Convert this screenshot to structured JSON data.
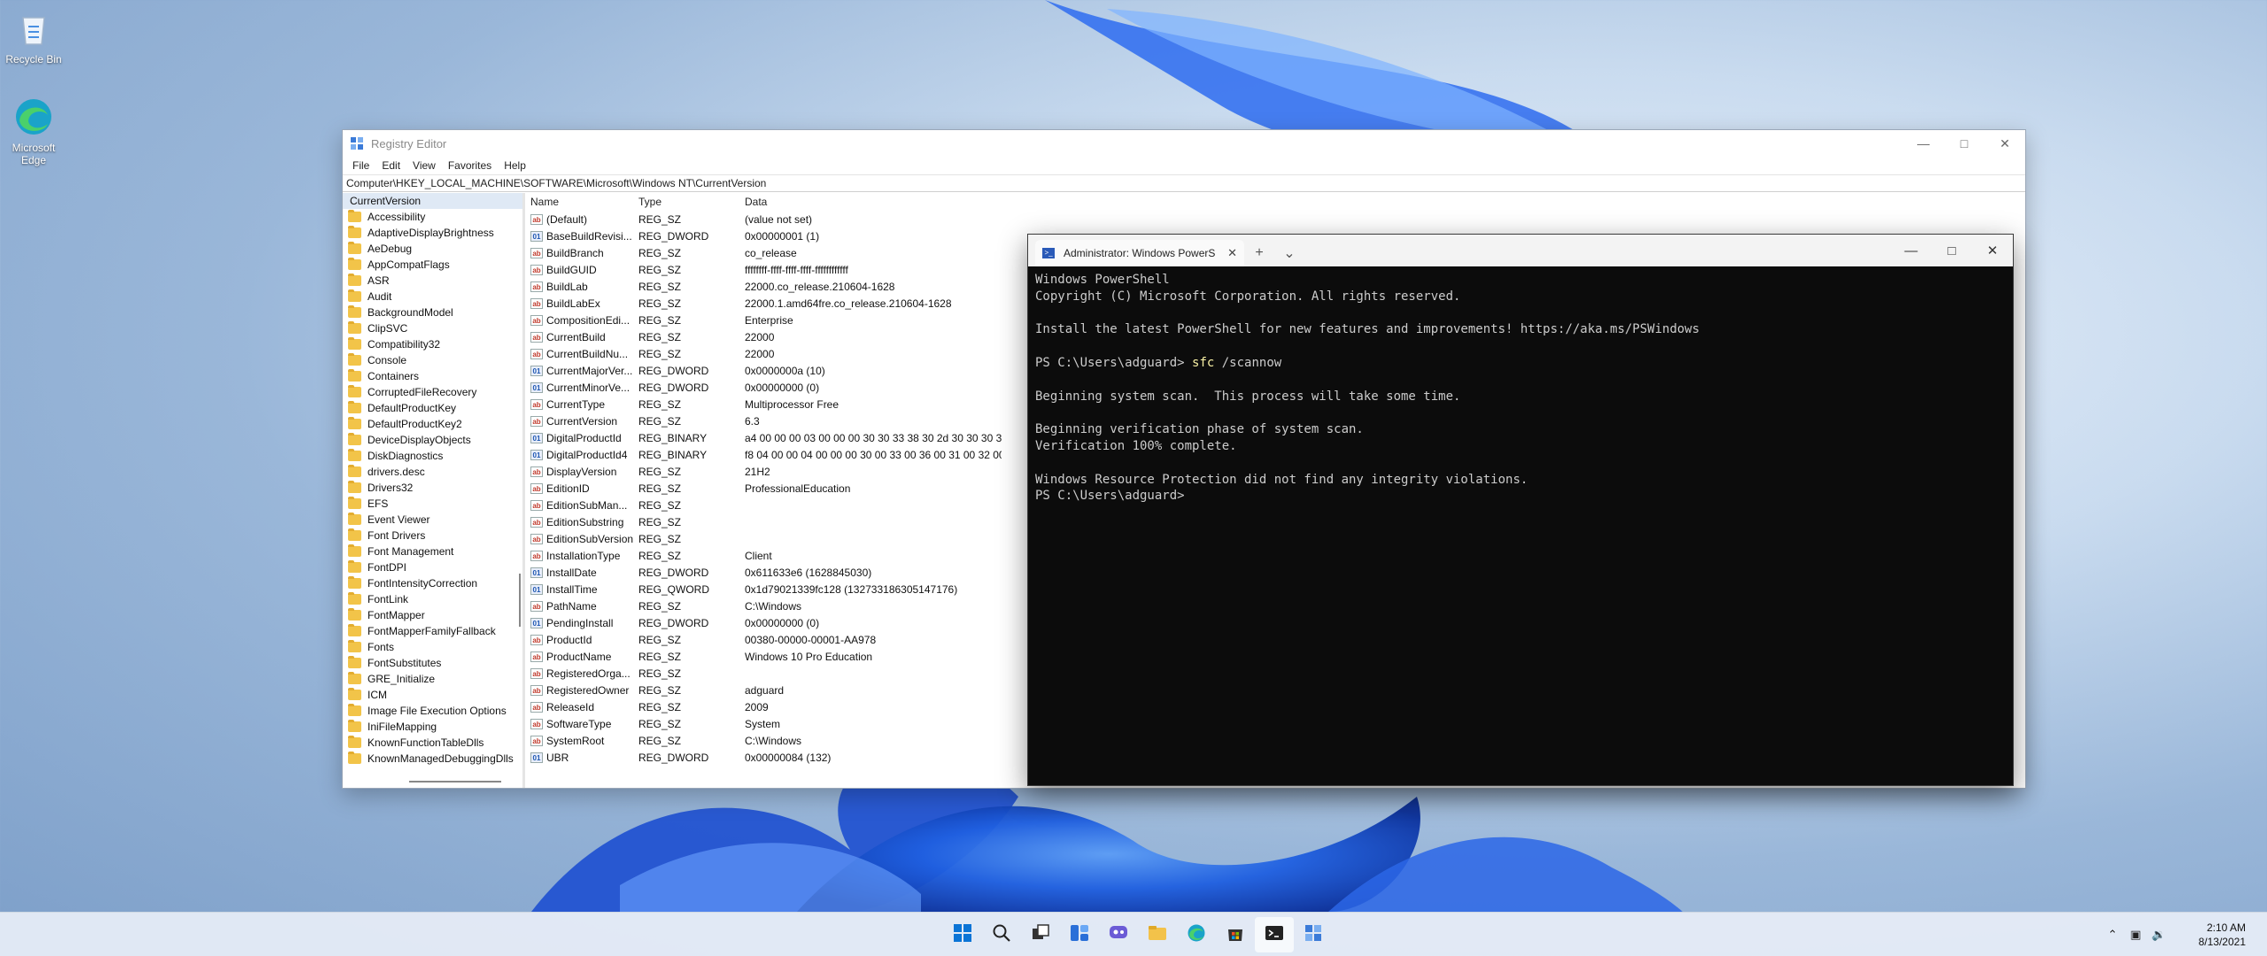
{
  "desktop": {
    "icons": [
      {
        "label": "Recycle Bin",
        "icon": "recycle-bin-icon"
      },
      {
        "label": "Microsoft Edge",
        "icon": "edge-icon"
      }
    ]
  },
  "regedit": {
    "title": "Registry Editor",
    "menu": [
      "File",
      "Edit",
      "View",
      "Favorites",
      "Help"
    ],
    "address": "Computer\\HKEY_LOCAL_MACHINE\\SOFTWARE\\Microsoft\\Windows NT\\CurrentVersion",
    "tree": [
      "CurrentVersion",
      "Accessibility",
      "AdaptiveDisplayBrightness",
      "AeDebug",
      "AppCompatFlags",
      "ASR",
      "Audit",
      "BackgroundModel",
      "ClipSVC",
      "Compatibility32",
      "Console",
      "Containers",
      "CorruptedFileRecovery",
      "DefaultProductKey",
      "DefaultProductKey2",
      "DeviceDisplayObjects",
      "DiskDiagnostics",
      "drivers.desc",
      "Drivers32",
      "EFS",
      "Event Viewer",
      "Font Drivers",
      "Font Management",
      "FontDPI",
      "FontIntensityCorrection",
      "FontLink",
      "FontMapper",
      "FontMapperFamilyFallback",
      "Fonts",
      "FontSubstitutes",
      "GRE_Initialize",
      "ICM",
      "Image File Execution Options",
      "IniFileMapping",
      "KnownFunctionTableDlls",
      "KnownManagedDebuggingDlls"
    ],
    "columns": {
      "name": "Name",
      "type": "Type",
      "data": "Data"
    },
    "values": [
      {
        "name": "(Default)",
        "type": "REG_SZ",
        "data": "(value not set)",
        "kind": "str"
      },
      {
        "name": "BaseBuildRevisi...",
        "type": "REG_DWORD",
        "data": "0x00000001 (1)",
        "kind": "bin"
      },
      {
        "name": "BuildBranch",
        "type": "REG_SZ",
        "data": "co_release",
        "kind": "str"
      },
      {
        "name": "BuildGUID",
        "type": "REG_SZ",
        "data": "ffffffff-ffff-ffff-ffff-ffffffffffff",
        "kind": "str"
      },
      {
        "name": "BuildLab",
        "type": "REG_SZ",
        "data": "22000.co_release.210604-1628",
        "kind": "str"
      },
      {
        "name": "BuildLabEx",
        "type": "REG_SZ",
        "data": "22000.1.amd64fre.co_release.210604-1628",
        "kind": "str"
      },
      {
        "name": "CompositionEdi...",
        "type": "REG_SZ",
        "data": "Enterprise",
        "kind": "str"
      },
      {
        "name": "CurrentBuild",
        "type": "REG_SZ",
        "data": "22000",
        "kind": "str"
      },
      {
        "name": "CurrentBuildNu...",
        "type": "REG_SZ",
        "data": "22000",
        "kind": "str"
      },
      {
        "name": "CurrentMajorVer...",
        "type": "REG_DWORD",
        "data": "0x0000000a (10)",
        "kind": "bin"
      },
      {
        "name": "CurrentMinorVe...",
        "type": "REG_DWORD",
        "data": "0x00000000 (0)",
        "kind": "bin"
      },
      {
        "name": "CurrentType",
        "type": "REG_SZ",
        "data": "Multiprocessor Free",
        "kind": "str"
      },
      {
        "name": "CurrentVersion",
        "type": "REG_SZ",
        "data": "6.3",
        "kind": "str"
      },
      {
        "name": "DigitalProductId",
        "type": "REG_BINARY",
        "data": "a4 00 00 00 03 00 00 00 30 30 33 38 30 2d 30 30 30 3...",
        "kind": "bin"
      },
      {
        "name": "DigitalProductId4",
        "type": "REG_BINARY",
        "data": "f8 04 00 00 04 00 00 00 30 00 33 00 36 00 31 00 32 00...",
        "kind": "bin"
      },
      {
        "name": "DisplayVersion",
        "type": "REG_SZ",
        "data": "21H2",
        "kind": "str"
      },
      {
        "name": "EditionID",
        "type": "REG_SZ",
        "data": "ProfessionalEducation",
        "kind": "str"
      },
      {
        "name": "EditionSubMan...",
        "type": "REG_SZ",
        "data": "",
        "kind": "str"
      },
      {
        "name": "EditionSubstring",
        "type": "REG_SZ",
        "data": "",
        "kind": "str"
      },
      {
        "name": "EditionSubVersion",
        "type": "REG_SZ",
        "data": "",
        "kind": "str"
      },
      {
        "name": "InstallationType",
        "type": "REG_SZ",
        "data": "Client",
        "kind": "str"
      },
      {
        "name": "InstallDate",
        "type": "REG_DWORD",
        "data": "0x611633e6 (1628845030)",
        "kind": "bin"
      },
      {
        "name": "InstallTime",
        "type": "REG_QWORD",
        "data": "0x1d79021339fc128 (132733186305147176)",
        "kind": "bin"
      },
      {
        "name": "PathName",
        "type": "REG_SZ",
        "data": "C:\\Windows",
        "kind": "str"
      },
      {
        "name": "PendingInstall",
        "type": "REG_DWORD",
        "data": "0x00000000 (0)",
        "kind": "bin"
      },
      {
        "name": "ProductId",
        "type": "REG_SZ",
        "data": "00380-00000-00001-AA978",
        "kind": "str"
      },
      {
        "name": "ProductName",
        "type": "REG_SZ",
        "data": "Windows 10 Pro Education",
        "kind": "str"
      },
      {
        "name": "RegisteredOrga...",
        "type": "REG_SZ",
        "data": "",
        "kind": "str"
      },
      {
        "name": "RegisteredOwner",
        "type": "REG_SZ",
        "data": "adguard",
        "kind": "str"
      },
      {
        "name": "ReleaseId",
        "type": "REG_SZ",
        "data": "2009",
        "kind": "str"
      },
      {
        "name": "SoftwareType",
        "type": "REG_SZ",
        "data": "System",
        "kind": "str"
      },
      {
        "name": "SystemRoot",
        "type": "REG_SZ",
        "data": "C:\\Windows",
        "kind": "str"
      },
      {
        "name": "UBR",
        "type": "REG_DWORD",
        "data": "0x00000084 (132)",
        "kind": "bin"
      }
    ]
  },
  "terminal": {
    "tab_title": "Administrator: Windows PowerS",
    "lines": [
      {
        "text": "Windows PowerShell"
      },
      {
        "text": "Copyright (C) Microsoft Corporation. All rights reserved."
      },
      {
        "text": ""
      },
      {
        "text": "Install the latest PowerShell for new features and improvements! https://aka.ms/PSWindows"
      },
      {
        "text": ""
      },
      {
        "prompt": "PS C:\\Users\\adguard> ",
        "cmd": "sfc",
        "text": " /scannow"
      },
      {
        "text": ""
      },
      {
        "text": "Beginning system scan.  This process will take some time."
      },
      {
        "text": ""
      },
      {
        "text": "Beginning verification phase of system scan."
      },
      {
        "text": "Verification 100% complete."
      },
      {
        "text": ""
      },
      {
        "text": "Windows Resource Protection did not find any integrity violations."
      },
      {
        "text": "PS C:\\Users\\adguard>"
      }
    ]
  },
  "taskbar": {
    "apps": [
      "start-icon",
      "search-icon",
      "task-view-icon",
      "widgets-icon",
      "chat-icon",
      "file-explorer-icon",
      "edge-icon",
      "store-icon",
      "terminal-icon",
      "regedit-icon"
    ],
    "clock": {
      "time": "2:10 AM",
      "date": "8/13/2021"
    }
  },
  "colors": {
    "accent": "#0067c0",
    "terminal_bg": "#0c0c0c",
    "terminal_fg": "#cccccc",
    "command": "#f9f1a5"
  }
}
